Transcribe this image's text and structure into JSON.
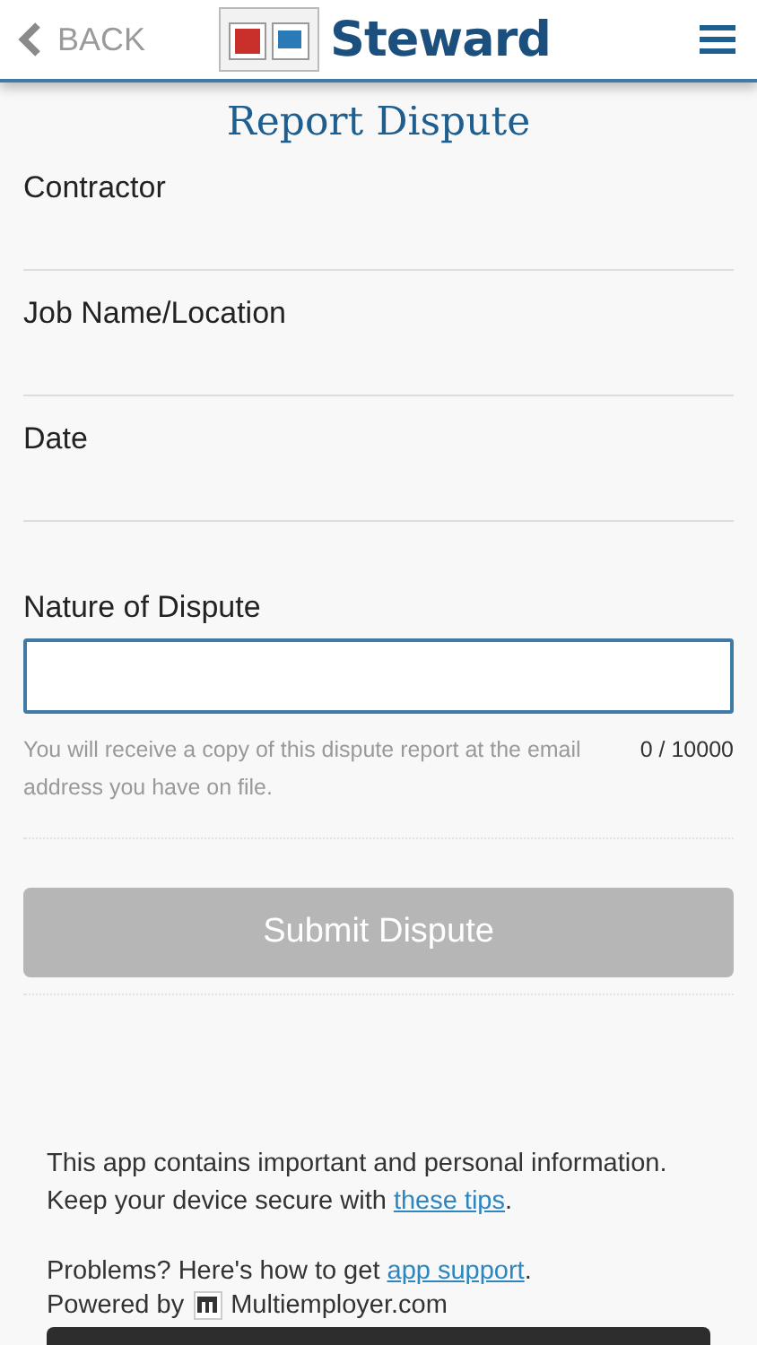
{
  "header": {
    "back_label": "BACK",
    "brand": "Steward"
  },
  "title": "Report Dispute",
  "fields": [
    {
      "label": "Contractor",
      "kind": "line"
    },
    {
      "label": "Job Name/Location",
      "kind": "line"
    },
    {
      "label": "Date",
      "kind": "line"
    },
    {
      "label": "Nature of Dispute",
      "kind": "box"
    }
  ],
  "hint": "You will receive a copy of this dispute report at the email address you have on file.",
  "counter": "0 / 10000",
  "submit": {
    "label": "Submit Dispute",
    "disabled": true
  },
  "footer": [
    {
      "before": "This app contains important and personal information. Keep your device secure with ",
      "link": "these tips",
      "after": "."
    },
    {
      "before": "Problems? Here's how to get ",
      "link": "app support",
      "after": "."
    }
  ],
  "powered": {
    "prefix": "Powered by",
    "name": "Multiemployer.com"
  }
}
